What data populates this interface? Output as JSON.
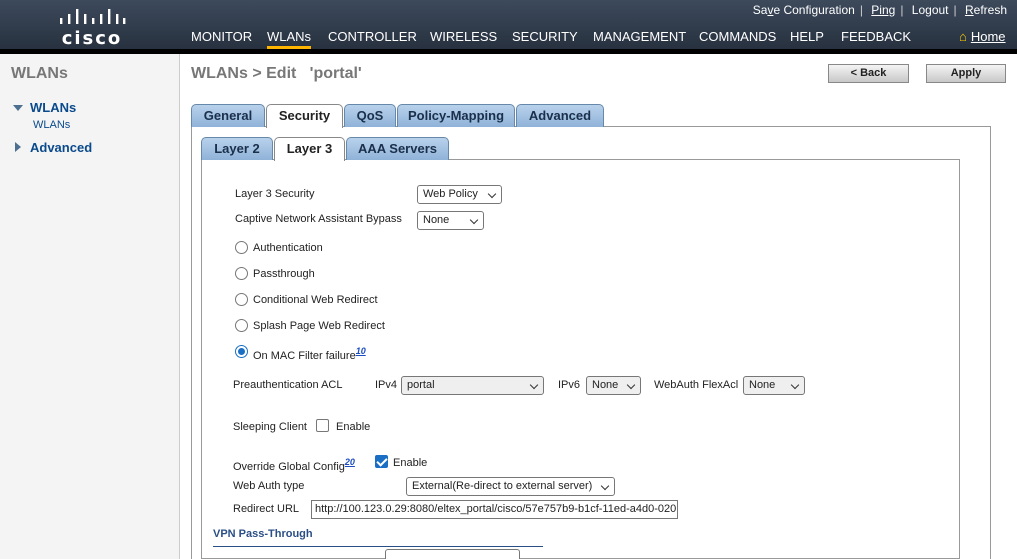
{
  "header": {
    "logo_text": "cisco",
    "top_links": [
      {
        "label": "Save Configuration",
        "underline_index": 2
      },
      {
        "label": "Ping"
      },
      {
        "label": "Logout"
      },
      {
        "label": "Refresh"
      }
    ],
    "nav": [
      {
        "label": "MONITOR",
        "active": false
      },
      {
        "label": "WLANs",
        "active": true
      },
      {
        "label": "CONTROLLER",
        "active": false
      },
      {
        "label": "WIRELESS",
        "active": false
      },
      {
        "label": "SECURITY",
        "active": false
      },
      {
        "label": "MANAGEMENT",
        "active": false
      },
      {
        "label": "COMMANDS",
        "active": false
      },
      {
        "label": "HELP",
        "active": false
      },
      {
        "label": "FEEDBACK",
        "active": false
      }
    ],
    "home_label": "Home"
  },
  "sidebar": {
    "title": "WLANs",
    "items": [
      {
        "label": "WLANs",
        "expanded": true,
        "children": [
          "WLANs"
        ]
      },
      {
        "label": "Advanced",
        "expanded": false
      }
    ]
  },
  "page": {
    "title": "WLANs > Edit   'portal'",
    "back_label": "< Back",
    "apply_label": "Apply"
  },
  "tabs": [
    "General",
    "Security",
    "QoS",
    "Policy-Mapping",
    "Advanced"
  ],
  "active_tab": "Security",
  "sub_tabs": [
    "Layer 2",
    "Layer 3",
    "AAA Servers"
  ],
  "active_sub_tab": "Layer 3",
  "form": {
    "layer3_security": {
      "label": "Layer 3 Security",
      "value": "Web Policy"
    },
    "cna_bypass": {
      "label": "Captive Network Assistant Bypass",
      "value": "None"
    },
    "radios": [
      {
        "label": "Authentication",
        "checked": false
      },
      {
        "label": "Passthrough",
        "checked": false
      },
      {
        "label": "Conditional Web Redirect",
        "checked": false
      },
      {
        "label": "Splash Page Web Redirect",
        "checked": false
      },
      {
        "label": "On MAC Filter failure",
        "checked": true,
        "footnote": "10"
      }
    ],
    "preauth_acl": {
      "label": "Preauthentication ACL",
      "ipv4_label": "IPv4",
      "ipv4_value": "portal",
      "ipv6_label": "IPv6",
      "ipv6_value": "None",
      "flexacl_label": "WebAuth FlexAcl",
      "flexacl_value": "None"
    },
    "sleeping_client": {
      "label": "Sleeping Client",
      "enable_label": "Enable",
      "checked": false
    },
    "override_global": {
      "label": "Override Global Config",
      "footnote": "20",
      "enable_label": "Enable",
      "checked": true
    },
    "web_auth_type": {
      "label": "Web Auth type",
      "value": "External(Re-direct to external server)"
    },
    "redirect_url": {
      "label": "Redirect URL",
      "value": "http://100.123.0.29:8080/eltex_portal/cisco/57e757b9-b1cf-11ed-a4d0-020"
    },
    "vpn_section_title": "VPN Pass-Through"
  },
  "colors": {
    "header_bg": "#2f3a4a",
    "nav_active_underline": "#ffb400",
    "tab_blue": "#a4c2e4",
    "link_blue": "#0a4a8c",
    "radio_check_blue": "#1a6fc4"
  }
}
